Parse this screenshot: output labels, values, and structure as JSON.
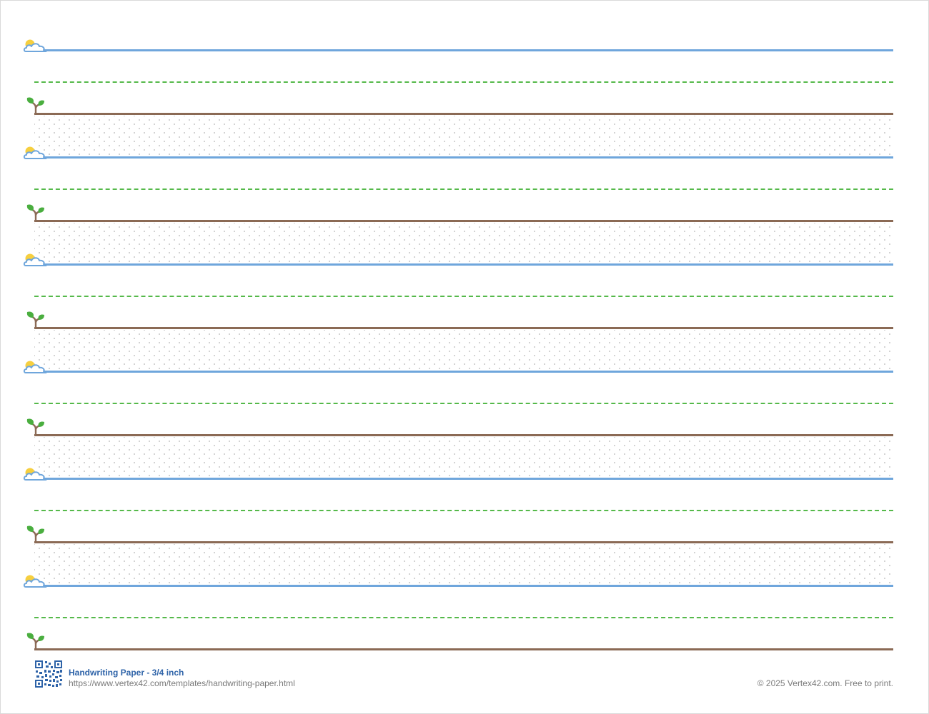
{
  "page": {
    "line_sets": 6,
    "colors": {
      "headline": "#6fa6dc",
      "midline": "#55b94a",
      "baseline": "#8b6a55",
      "dots": "#c8c8c8",
      "title_text": "#2e63a8",
      "footer_text": "#7a7a7a"
    },
    "icons": {
      "headline": "sun-cloud-icon",
      "baseline": "sprout-icon",
      "footer": "qr-code-icon"
    }
  },
  "footer": {
    "title": "Handwriting Paper - 3/4 inch",
    "url": "https://www.vertex42.com/templates/handwriting-paper.html",
    "copyright": "© 2025 Vertex42.com. Free to print."
  }
}
